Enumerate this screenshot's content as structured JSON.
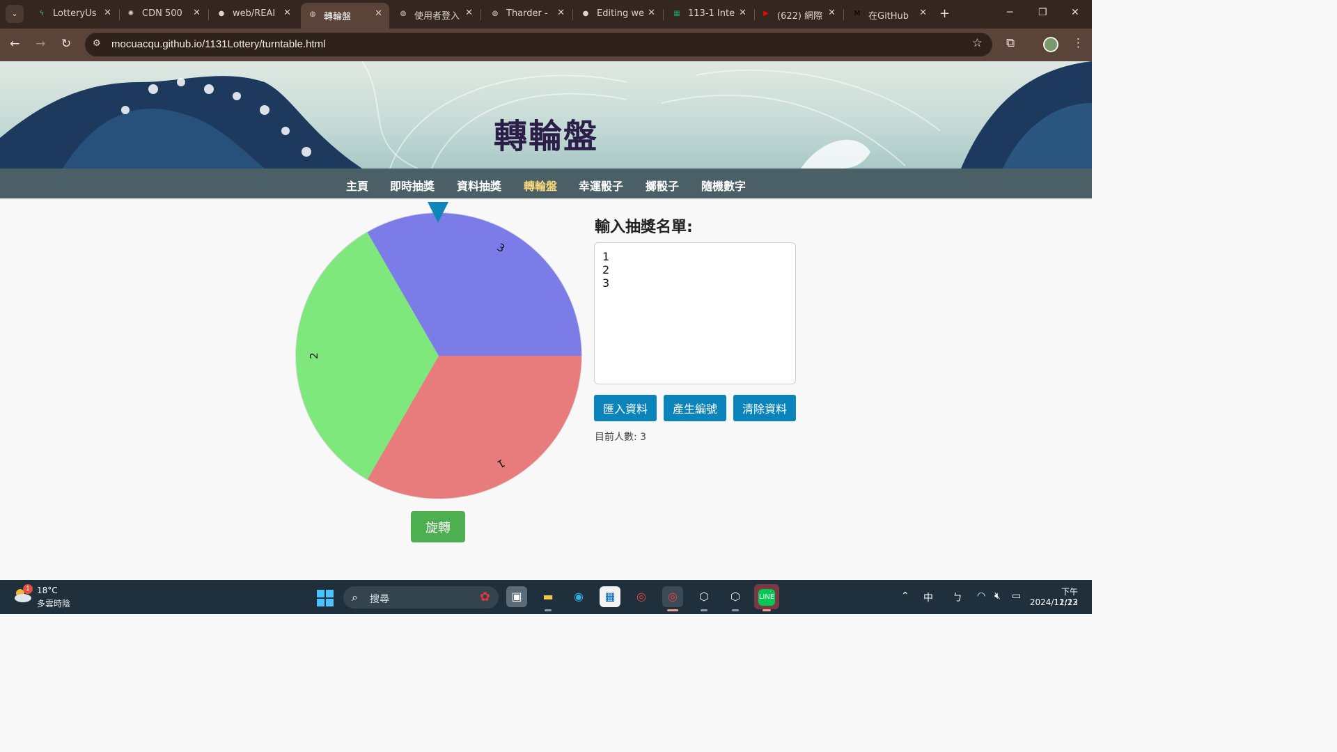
{
  "browser": {
    "tabs": [
      {
        "title": "LotteryUs",
        "icon": "bolt-icon",
        "color": "#3ccf7a"
      },
      {
        "title": "CDN 500",
        "icon": "openai-icon",
        "color": "#dcd3cd"
      },
      {
        "title": "web/REAI",
        "icon": "github-icon",
        "color": "#dcd3cd"
      },
      {
        "title": "轉輪盤",
        "icon": "globe-icon",
        "color": "#dcd3cd",
        "active": true
      },
      {
        "title": "使用者登入",
        "icon": "globe-icon",
        "color": "#dcd3cd"
      },
      {
        "title": "Tharder -",
        "icon": "globe-icon",
        "color": "#dcd3cd"
      },
      {
        "title": "Editing we",
        "icon": "github-icon",
        "color": "#dcd3cd"
      },
      {
        "title": "113-1 Inte",
        "icon": "sheets-icon",
        "color": "#21a366"
      },
      {
        "title": "(622) 網際",
        "icon": "youtube-icon",
        "color": "#ff0000"
      },
      {
        "title": "在GitHub",
        "icon": "medium-icon",
        "color": "#000000"
      }
    ],
    "url": "mocuacqu.github.io/1131Lottery/turntable.html"
  },
  "page": {
    "title": "轉輪盤",
    "nav": [
      "主頁",
      "即時抽獎",
      "資料抽獎",
      "轉輪盤",
      "幸運骰子",
      "擲骰子",
      "隨機數字"
    ],
    "current_nav": "轉輪盤",
    "spin_label": "旋轉",
    "panel_title": "輸入抽獎名單:",
    "names_text": "1\n2\n3",
    "buttons": {
      "import": "匯入資料",
      "number": "產生編號",
      "clear": "清除資料"
    },
    "count_text": "目前人數: 3"
  },
  "wheel": {
    "segments": [
      {
        "label": "1",
        "color": "#e87c7c"
      },
      {
        "label": "2",
        "color": "#7ee87c"
      },
      {
        "label": "3",
        "color": "#7c7ce8"
      }
    ],
    "pointer_color": "#0f86b8"
  },
  "taskbar": {
    "temperature": "18°C",
    "weather": "多雲時陰",
    "weather_badge": "1",
    "search_placeholder": "搜尋",
    "ime": "中",
    "ime2": "ㄅ",
    "time": "下午 11:23",
    "date": "2024/12/12"
  }
}
